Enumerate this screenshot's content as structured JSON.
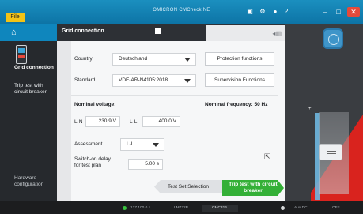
{
  "titlebar": {
    "file_label": "File",
    "title": "OMICRON CMCheck NE",
    "icons": [
      "window-icon",
      "settings-icon",
      "info-icon",
      "help-icon"
    ],
    "window_controls": [
      "minimize",
      "maximize",
      "close"
    ]
  },
  "sidebar": {
    "home_icon": "home-icon",
    "device_icon": "inverter-icon",
    "items": [
      {
        "label": "Grid connection",
        "selected": true
      },
      {
        "label": "Trip test with circuit breaker",
        "selected": false
      }
    ],
    "hardware_label": "Hardware configuration"
  },
  "panel": {
    "title": "Grid connection",
    "country_label": "Country:",
    "country_value": "Deutschland",
    "standard_label": "Standard:",
    "standard_value": "VDE-AR-N4105:2018",
    "protection_btn": "Protection functions",
    "supervision_btn": "Supervision Functions",
    "nominal_voltage_label": "Nominal voltage:",
    "nominal_frequency_label": "Nominal frequency: 50 Hz",
    "ln_label": "L-N",
    "ln_value": "230.9 V",
    "ll_label": "L-L",
    "ll_value": "400.0 V",
    "assessment_label": "Assessment",
    "assessment_value": "L-L",
    "switch_on_label": "Switch-on delay for test plan",
    "switch_on_value": "5.00 s",
    "test_set_selection": "Test Set Selection",
    "trip_test_button": "Trip test with circuit breaker"
  },
  "statusbar": {
    "ip": "127.100.0.1",
    "device": "LM722P",
    "mode": "CMC316",
    "power": "Aux DC",
    "state": "OFF"
  },
  "colors": {
    "accent_blue": "#0f86bd",
    "go_green": "#34b037",
    "alert_red": "#d9231e",
    "file_yellow": "#f3c316"
  }
}
